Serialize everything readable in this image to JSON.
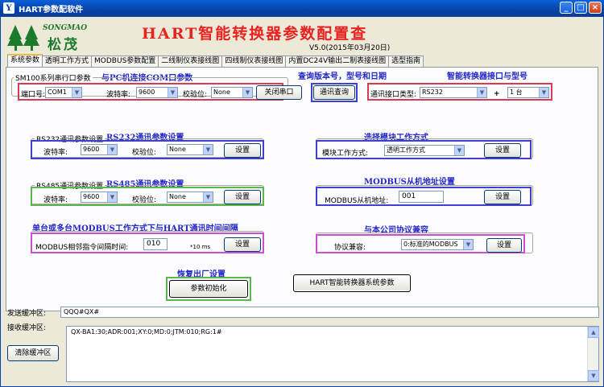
{
  "window": {
    "title": "HART参数配软件",
    "app_icon": "Y",
    "buttons": [
      "_",
      "□",
      "×"
    ]
  },
  "logo": {
    "brand": "SONGMAO",
    "cn": "松茂"
  },
  "header": {
    "title": "HART智能转换器参数配置查",
    "version": "V5.0(2015年03月20日)"
  },
  "tabs": [
    "系统参数",
    "透明工作方式",
    "MODBUS参数配置",
    "二线制仪表接线图",
    "四线制仪表接线图",
    "内置DC24V输出二制表接线图",
    "选型指南"
  ],
  "annotations": {
    "pc_conn": "与PC机连接COM口参数",
    "query_ver": "查询版本号，型号和日期",
    "port_model": "智能转换器接口与型号",
    "rs232": "RS232通讯参数设置",
    "mode": "选择模块工作方式",
    "rs485": "RS485通讯参数设置",
    "modbus_addr": "MODBUS从机地址设置",
    "interval": "单台或多台MODBUS工作方式下与HART通讯时间间隔",
    "compat": "与本公司协议兼容",
    "factory": "恢复出厂设置"
  },
  "serial": {
    "group_title": "SM100系列串行口参数",
    "port_label": "端口号:",
    "port_value": "COM1",
    "baud_label": "波特率:",
    "baud_value": "9600",
    "parity_label": "校验位:",
    "parity_value": "None",
    "close_btn": "关闭串口"
  },
  "query_btn": "通讯查询",
  "port_type": {
    "label": "通讯接口类型:",
    "value": "RS232",
    "plus": "+",
    "count": "1 台"
  },
  "rs232": {
    "title": "RS232通讯参数设置",
    "baud_label": "波特率:",
    "baud_value": "9600",
    "parity_label": "校验位:",
    "parity_value": "None",
    "set_btn": "设置"
  },
  "mode": {
    "label": "模块工作方式:",
    "value": "透明工作方式",
    "set_btn": "设置"
  },
  "rs485": {
    "title": "RS485通讯参数设置",
    "baud_label": "波特率:",
    "baud_value": "9600",
    "parity_label": "校验位:",
    "parity_value": "None",
    "set_btn": "设置"
  },
  "modbus_addr": {
    "label": "MODBUS从机地址:",
    "value": "001",
    "set_btn": "设置"
  },
  "interval": {
    "label": "MODBUS相邻指令间隔时间:",
    "value": "010",
    "unit": "*10 ms",
    "set_btn": "设置"
  },
  "compat": {
    "label": "协议兼容:",
    "value": "0:标准的MODBUS",
    "set_btn": "设置"
  },
  "init_btn": "参数初始化",
  "sys_param_btn": "HART智能转换器系统参数",
  "send": {
    "label": "发送缓冲区:",
    "value": "QQQ#QX#"
  },
  "recv": {
    "label": "接收缓冲区:",
    "value": "QX-BA1:30;ADR:001;XY:0;MD:0;JTM:010;RG:1#"
  },
  "clear_btn": "清除缓冲区"
}
